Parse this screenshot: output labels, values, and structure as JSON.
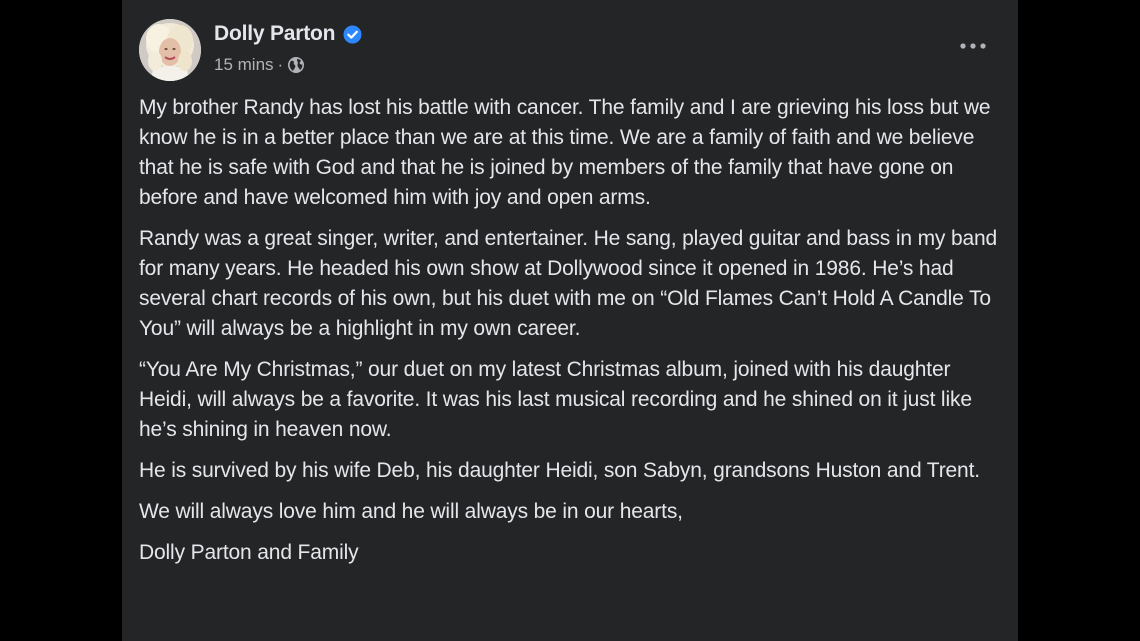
{
  "post": {
    "author": "Dolly Parton",
    "verified": true,
    "timestamp": "15 mins",
    "separator": "·",
    "audience_icon": "globe-icon",
    "more_icon": "more-horizontal-icon",
    "paragraphs": [
      "My brother Randy has lost his battle with cancer. The family and I are grieving his loss but we know he is in a better place than we are at this time. We are a family of faith and we believe that he is safe with God and that he is joined by members of the family that have gone on before and have welcomed him with joy and open arms.",
      "Randy was a great singer, writer, and entertainer. He sang, played guitar and bass in my band for many years. He headed his own show at Dollywood since it opened in 1986. He’s had several chart records of his own, but his duet with me on “Old Flames Can’t Hold A Candle To You” will always be a highlight in my own career.",
      "“You Are My Christmas,” our duet on my latest Christmas album, joined with his daughter Heidi, will always be a favorite. It was his last musical recording and he shined on it just like he’s shining in heaven now.",
      "He is survived by his wife Deb, his daughter Heidi, son Sabyn, grandsons Huston and Trent.",
      "We will always love him and he will always be in our hearts,",
      "Dolly Parton and Family"
    ]
  },
  "colors": {
    "card_background": "#242526",
    "page_background": "#000000",
    "primary_text": "#e4e6eb",
    "secondary_text": "#b0b3b8",
    "verified_badge": "#2d88ff"
  }
}
